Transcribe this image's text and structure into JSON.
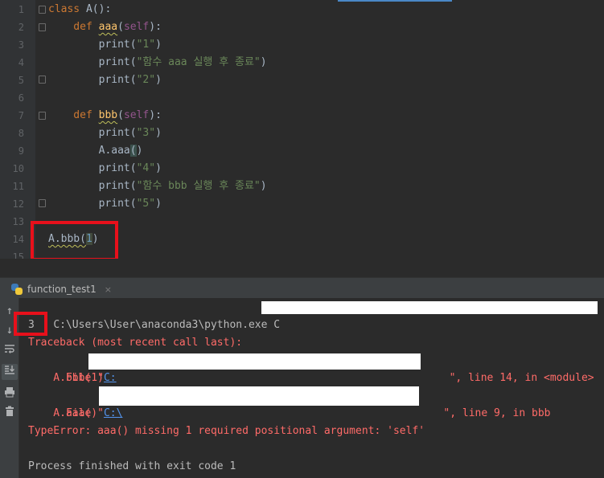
{
  "editor": {
    "lines": [
      {
        "n": "1",
        "tokens": [
          {
            "t": "class ",
            "c": "kw"
          },
          {
            "t": "A():",
            "c": "plain"
          }
        ]
      },
      {
        "n": "2",
        "tokens": [
          {
            "t": "    def ",
            "c": "kw"
          },
          {
            "t": "aaa",
            "c": "fn wavy"
          },
          {
            "t": "(",
            "c": "plain"
          },
          {
            "t": "self",
            "c": "self"
          },
          {
            "t": "):",
            "c": "plain"
          }
        ]
      },
      {
        "n": "3",
        "tokens": [
          {
            "t": "        print(",
            "c": "plain"
          },
          {
            "t": "\"1\"",
            "c": "str"
          },
          {
            "t": ")",
            "c": "plain"
          }
        ]
      },
      {
        "n": "4",
        "tokens": [
          {
            "t": "        print(",
            "c": "plain"
          },
          {
            "t": "\"함수 aaa 실행 후 종료\"",
            "c": "str"
          },
          {
            "t": ")",
            "c": "plain"
          }
        ]
      },
      {
        "n": "5",
        "tokens": [
          {
            "t": "        print(",
            "c": "plain"
          },
          {
            "t": "\"2\"",
            "c": "str"
          },
          {
            "t": ")",
            "c": "plain"
          }
        ]
      },
      {
        "n": "6",
        "tokens": []
      },
      {
        "n": "7",
        "tokens": [
          {
            "t": "    def ",
            "c": "kw"
          },
          {
            "t": "bbb",
            "c": "fn wavy"
          },
          {
            "t": "(",
            "c": "plain"
          },
          {
            "t": "self",
            "c": "self"
          },
          {
            "t": "):",
            "c": "plain"
          }
        ]
      },
      {
        "n": "8",
        "tokens": [
          {
            "t": "        print(",
            "c": "plain"
          },
          {
            "t": "\"3\"",
            "c": "str"
          },
          {
            "t": ")",
            "c": "plain"
          }
        ]
      },
      {
        "n": "9",
        "tokens": [
          {
            "t": "        A.aaa",
            "c": "plain"
          },
          {
            "t": "(",
            "c": "plain hl"
          },
          {
            "t": ")",
            "c": "plain"
          }
        ]
      },
      {
        "n": "10",
        "tokens": [
          {
            "t": "        print(",
            "c": "plain"
          },
          {
            "t": "\"4\"",
            "c": "str"
          },
          {
            "t": ")",
            "c": "plain"
          }
        ]
      },
      {
        "n": "11",
        "tokens": [
          {
            "t": "        print(",
            "c": "plain"
          },
          {
            "t": "\"함수 bbb 실행 후 종료\"",
            "c": "str"
          },
          {
            "t": ")",
            "c": "plain"
          }
        ]
      },
      {
        "n": "12",
        "tokens": [
          {
            "t": "        print(",
            "c": "plain"
          },
          {
            "t": "\"5\"",
            "c": "str"
          },
          {
            "t": ")",
            "c": "plain"
          }
        ]
      },
      {
        "n": "13",
        "tokens": []
      },
      {
        "n": "14",
        "tokens": [
          {
            "t": "A.bbb(",
            "c": "plain wavy"
          },
          {
            "t": "1",
            "c": "caret-hl"
          },
          {
            "t": ")",
            "c": "plain"
          }
        ]
      },
      {
        "n": "15",
        "tokens": []
      }
    ]
  },
  "run": {
    "tab_label": "function_test1",
    "tab_close": "×"
  },
  "console": {
    "cmd_prefix": "C:\\Users\\User\\anaconda3\\python.exe C",
    "out_3": "3",
    "traceback_header": "Traceback (most recent call last):",
    "frame1_prefix": "  File \"",
    "frame1_link": "C:",
    "frame1_suffix": "\", line 14, in <module>",
    "frame1_code": "    A.bbb(1)",
    "frame2_prefix": "  File \"",
    "frame2_link": "C:\\",
    "frame2_suffix": "\", line 9, in bbb",
    "frame2_code": "    A.aaa()",
    "error": "TypeError: aaa() missing 1 required positional argument: 'self'",
    "exit": "Process finished with exit code 1"
  },
  "colors": {
    "highlight_box": "#e8101b",
    "error_text": "#ff6b68",
    "link": "#5394ec"
  }
}
